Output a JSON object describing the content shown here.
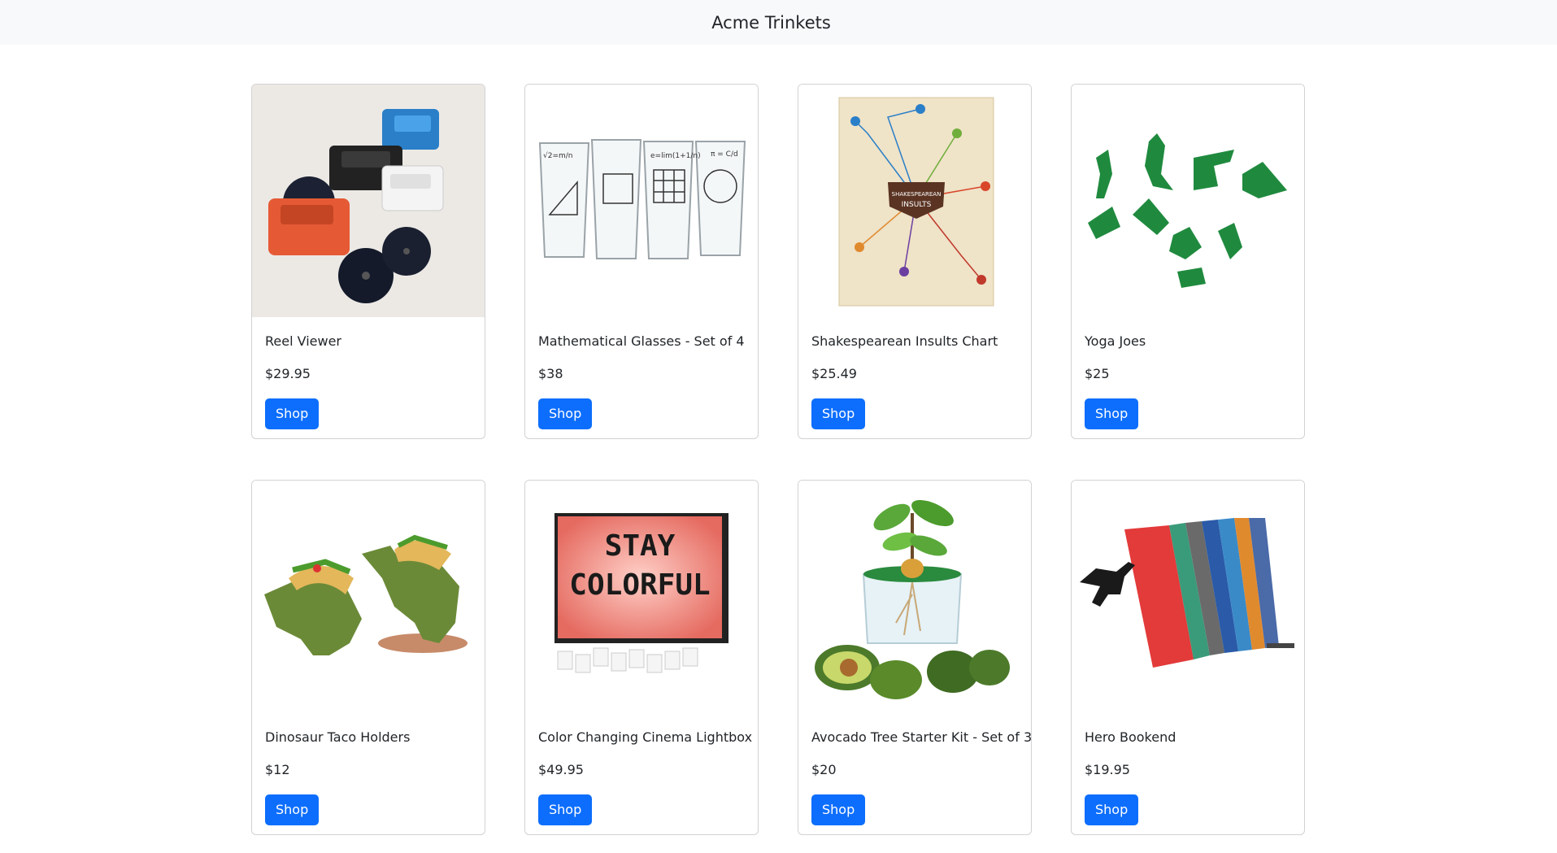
{
  "header": {
    "brand": "Acme Trinkets"
  },
  "colors": {
    "accent": "#0d6efd",
    "navbar_bg": "#f8f9fa"
  },
  "products": [
    {
      "name": "Reel Viewer",
      "price": "$29.95",
      "button": "Shop",
      "image": "reel-viewer-image"
    },
    {
      "name": "Mathematical Glasses - Set of 4",
      "price": "$38",
      "button": "Shop",
      "image": "math-glasses-image"
    },
    {
      "name": "Shakespearean Insults Chart",
      "price": "$25.49",
      "button": "Shop",
      "image": "insults-chart-image",
      "image_text": {
        "line1": "SHAKESPEAREAN",
        "line2": "INSULTS"
      }
    },
    {
      "name": "Yoga Joes",
      "price": "$25",
      "button": "Shop",
      "image": "yoga-joes-image"
    },
    {
      "name": "Dinosaur Taco Holders",
      "price": "$12",
      "button": "Shop",
      "image": "dino-taco-image"
    },
    {
      "name": "Color Changing Cinema Lightbox",
      "price": "$49.95",
      "button": "Shop",
      "image": "lightbox-image",
      "image_text": {
        "line1": "STAY",
        "line2": "COLORFUL"
      }
    },
    {
      "name": "Avocado Tree Starter Kit - Set of 3",
      "price": "$20",
      "button": "Shop",
      "image": "avocado-kit-image"
    },
    {
      "name": "Hero Bookend",
      "price": "$19.95",
      "button": "Shop",
      "image": "hero-bookend-image"
    }
  ]
}
